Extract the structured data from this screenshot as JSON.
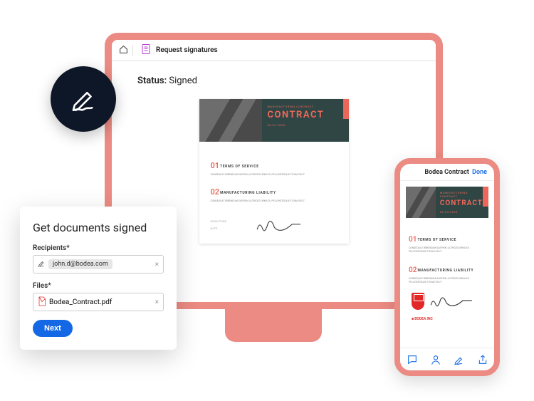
{
  "monitor": {
    "topbar": {
      "breadcrumb": "Request signatures"
    },
    "status_label": "Status:",
    "status_value": "Signed",
    "document": {
      "subheading": "MANUFACTURING CONTRACT",
      "title": "CONTRACT",
      "date": "03.04.2023",
      "sections": [
        {
          "num": "01",
          "title": "TERMS OF SERVICE",
          "text": "CONSEQUAT BIBENDUM SAEPIEN, ULTRICES URNA EU PELLENTESQUE ETIAM VELIT"
        },
        {
          "num": "02",
          "title": "MANUFACTURING LIABILITY",
          "text": "CONSEQUAT BIBENDUM SAEPIEN, ULTRICES URNA EU PELLENTESQUE ETIAM VELIT"
        }
      ],
      "sig_label_1": "SIGNATURE",
      "sig_label_2": "DATE"
    }
  },
  "popup": {
    "title": "Get documents signed",
    "recipients_label": "Recipients*",
    "recipient_chip": "john.d@bodea.com",
    "files_label": "Files*",
    "file_name": "Bodea_Contract.pdf",
    "next_label": "Next"
  },
  "phone": {
    "header_title": "Bodea Contract",
    "done_label": "Done",
    "adobe_tag": "■ BODEA INC"
  },
  "colors": {
    "accent": "#EB8B83",
    "primary": "#1468e6",
    "dark": "#0e1727",
    "doc": "#EC6759"
  }
}
